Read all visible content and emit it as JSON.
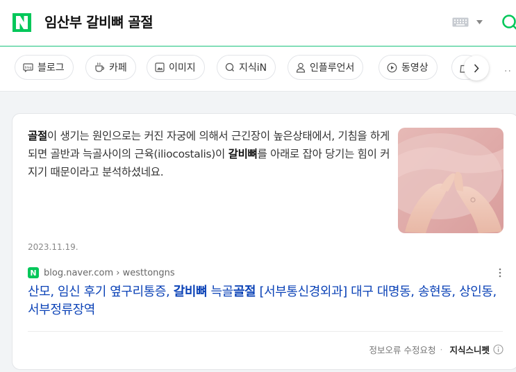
{
  "header": {
    "logo_letter": "N",
    "query": "임산부 갈비뼈 골절",
    "brand_color": "#03c75a"
  },
  "tabs": [
    {
      "label": "블로그",
      "icon": "blog-icon"
    },
    {
      "label": "카페",
      "icon": "cafe-cup-icon"
    },
    {
      "label": "이미지",
      "icon": "image-icon"
    },
    {
      "label": "지식iN",
      "icon": "kin-icon"
    },
    {
      "label": "인플루언서",
      "icon": "person-icon"
    },
    {
      "label": "동영상",
      "icon": "play-icon"
    }
  ],
  "result": {
    "snippet_parts": [
      {
        "t": "골절",
        "b": true
      },
      {
        "t": "이 생기는 원인으로는 커진 자궁에 의해서 근긴장이 높은상태에서, 기침을 하게되면 골반과 늑골사이의 근육(iliocostalis)이 ",
        "b": false
      },
      {
        "t": "갈비뼈",
        "b": true
      },
      {
        "t": "를 아래로 잡아 당기는 힘이 커지기 때문이라고 분석하셨네요.",
        "b": false
      }
    ],
    "date": "2023.11.19.",
    "source": "blog.naver.com › westtongns",
    "title_parts": [
      {
        "t": "산모, 임신 후기 옆구리통증, ",
        "b": false
      },
      {
        "t": "갈비뼈",
        "b": true
      },
      {
        "t": " 늑골",
        "b": false
      },
      {
        "t": "골절",
        "b": true
      },
      {
        "t": " [서부통신경외과] 대구 대명동, 송현동, 상인동, 서부정류장역",
        "b": false
      }
    ],
    "title_color": "#0c43b7"
  },
  "footer": {
    "report": "정보오류 수정요청",
    "separator": "·",
    "brand": "지식스니펫"
  }
}
